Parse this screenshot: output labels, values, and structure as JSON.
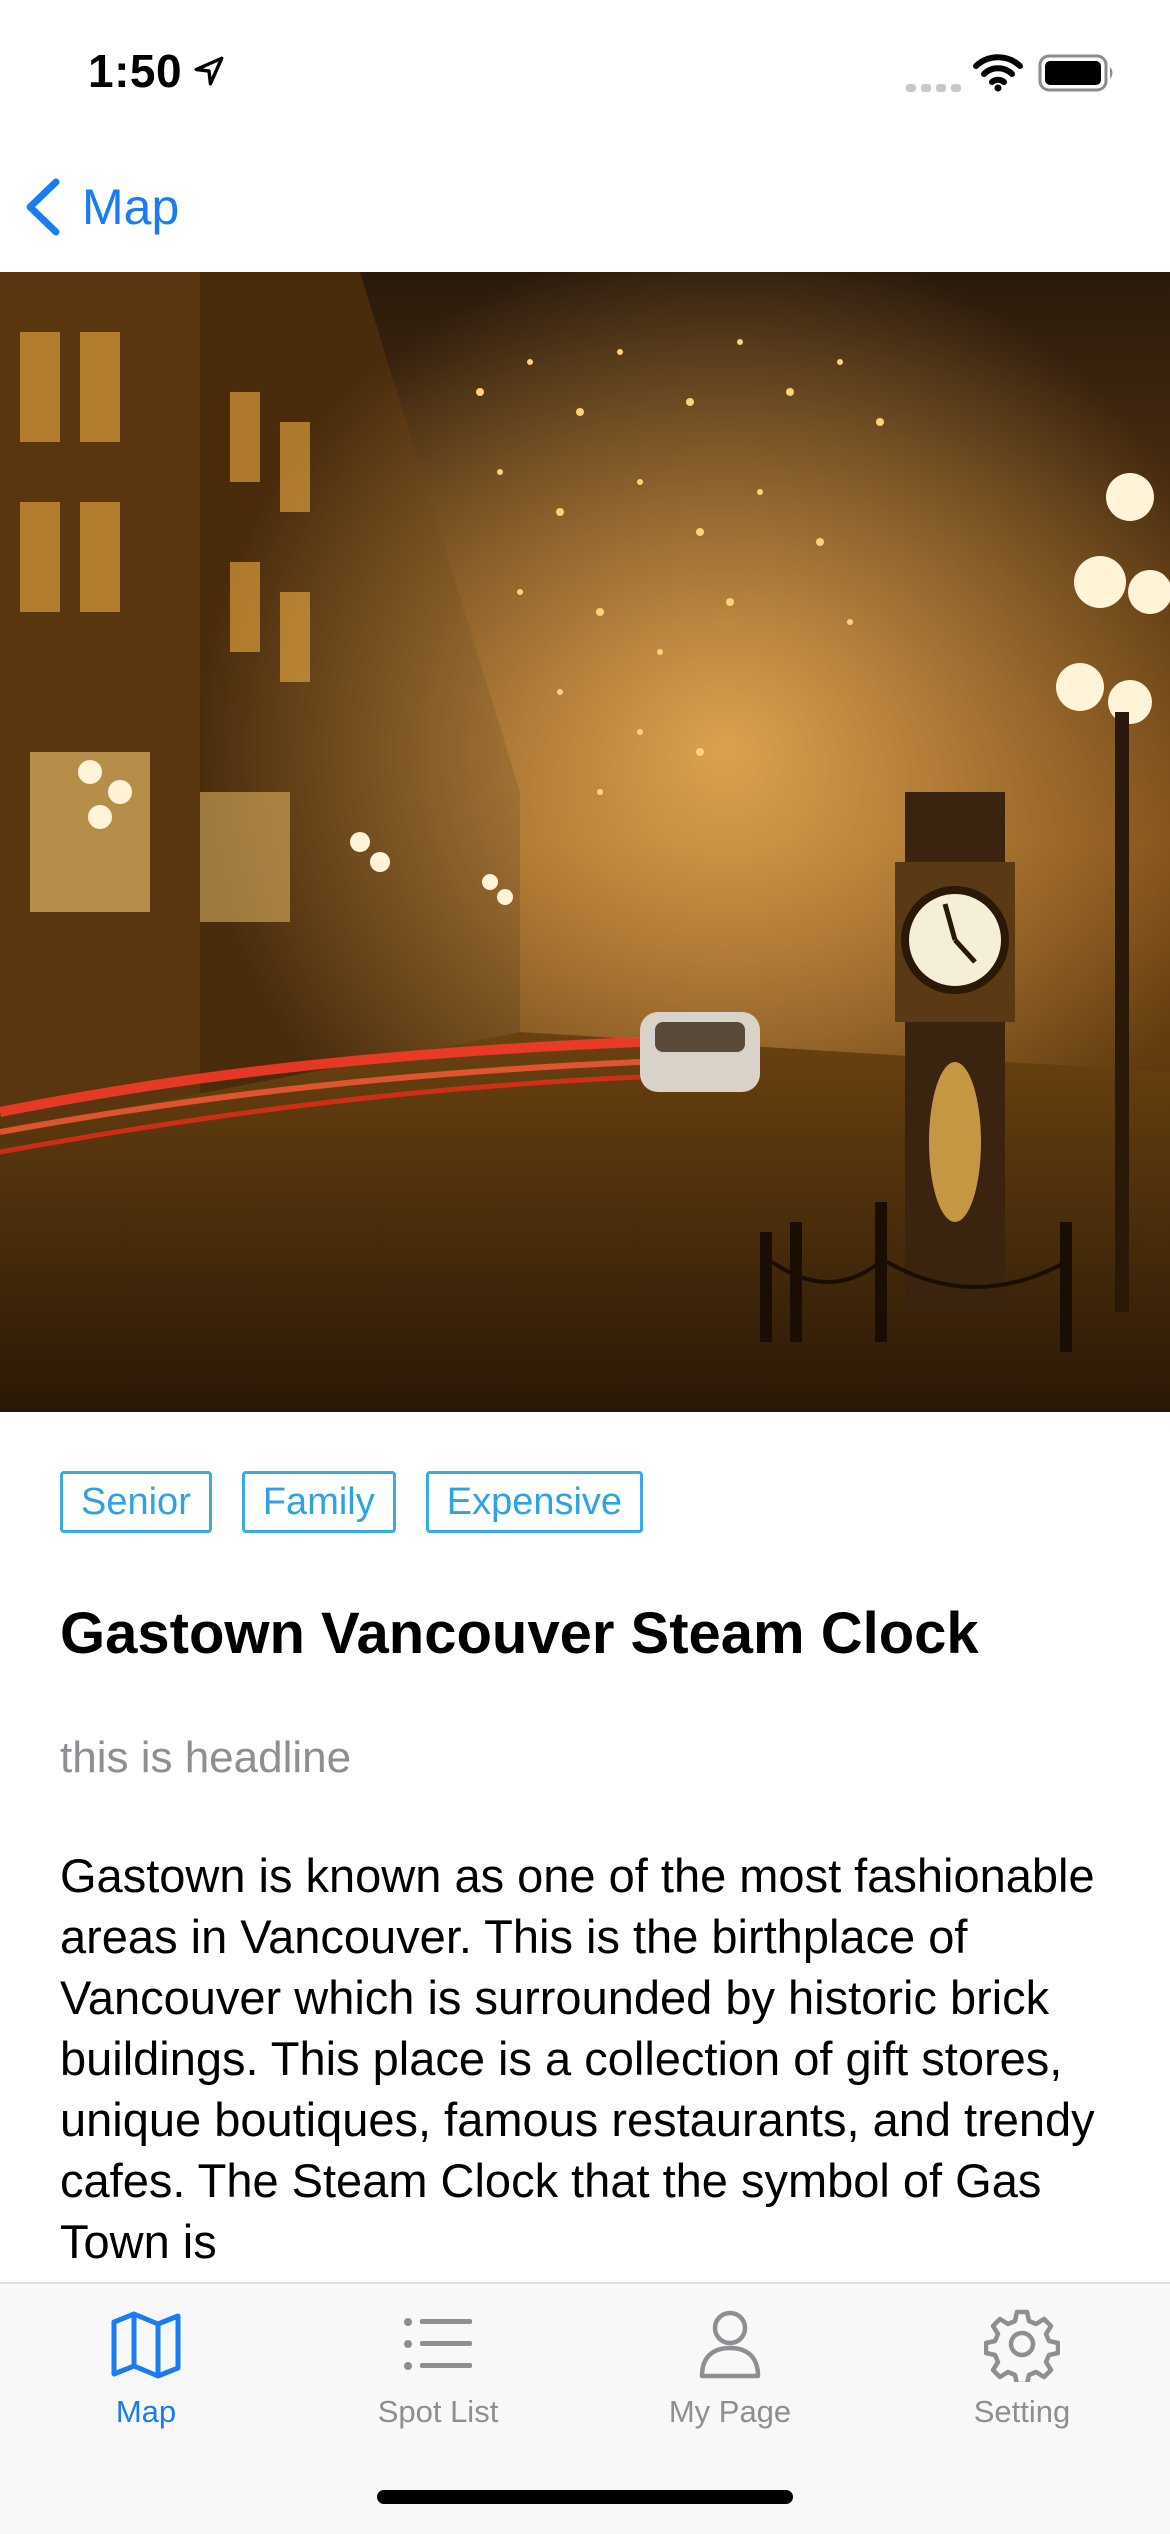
{
  "status_bar": {
    "time": "1:50",
    "icons": [
      "location-arrow-icon",
      "signal-icon",
      "wifi-icon",
      "battery-icon"
    ]
  },
  "nav": {
    "back_label": "Map",
    "accent_color": "#1a7cf2"
  },
  "spot": {
    "tags": [
      "Senior",
      "Family",
      "Expensive"
    ],
    "title": "Gastown Vancouver Steam Clock",
    "headline": "this is headline",
    "description": "Gastown is known as one of the most fashionable areas in Vancouver. This is the birthplace of Vancouver which is surrounded by historic brick buildings.  This place is a collection of gift stores, unique boutiques, famous restaurants, and trendy cafes. The Steam Clock that the symbol of Gas Town is"
  },
  "tab_bar": {
    "items": [
      {
        "label": "Map",
        "icon": "map-icon",
        "active": true
      },
      {
        "label": "Spot List",
        "icon": "list-icon",
        "active": false
      },
      {
        "label": "My Page",
        "icon": "person-icon",
        "active": false
      },
      {
        "label": "Setting",
        "icon": "gear-icon",
        "active": false
      }
    ]
  },
  "colors": {
    "accent": "#1a7cf2",
    "tag_border": "#3aa9e6",
    "inactive": "#8e8e93"
  }
}
